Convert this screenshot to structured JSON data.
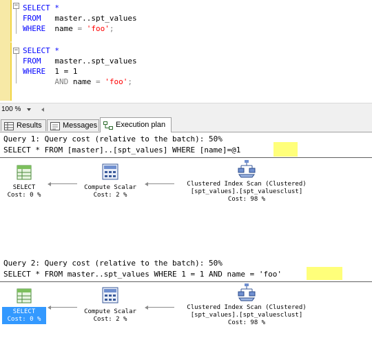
{
  "editor": {
    "block1": {
      "line1": "SELECT *",
      "line2_kw": "FROM",
      "line2_obj": "master..spt_values",
      "line3_kw": "WHERE",
      "line3_col": "name",
      "line3_op": "=",
      "line3_val": "'foo'",
      "line3_end": ";"
    },
    "block2": {
      "line1": "SELECT *",
      "line2_kw": "FROM",
      "line2_obj": "master..spt_values",
      "line3_kw": "WHERE",
      "line3_expr": "1 = 1",
      "line4_kw": "AND",
      "line4_col": "name",
      "line4_op": "=",
      "line4_val": "'foo'",
      "line4_end": ";"
    }
  },
  "zoom": {
    "value": "100 %"
  },
  "tabs": [
    {
      "label": "Results",
      "icon": "results-grid-icon"
    },
    {
      "label": "Messages",
      "icon": "messages-icon"
    },
    {
      "label": "Execution plan",
      "icon": "execution-plan-icon",
      "active": true
    }
  ],
  "plan": {
    "query1": {
      "header": "Query 1: Query cost (relative to the batch): 50%",
      "sql": "SELECT * FROM [master]..[spt_values] WHERE [name]=",
      "param": "@1",
      "nodes": [
        {
          "name": "SELECT",
          "cost": "Cost: 0 %",
          "icon": "select-icon"
        },
        {
          "name": "Compute Scalar",
          "cost": "Cost: 2 %",
          "icon": "compute-scalar-icon"
        },
        {
          "name": "Clustered Index Scan (Clustered)",
          "object": "[spt_values].[spt_valuesclust]",
          "cost": "Cost: 98 %",
          "icon": "clustered-index-scan-icon"
        }
      ]
    },
    "query2": {
      "header": "Query 2: Query cost (relative to the batch): 50%",
      "sql": "SELECT * FROM master..spt_values WHERE 1 = 1 AND name = ",
      "param": "'foo'",
      "nodes": [
        {
          "name": "SELECT",
          "cost": "Cost: 0 %",
          "icon": "select-icon",
          "selected": true
        },
        {
          "name": "Compute Scalar",
          "cost": "Cost: 2 %",
          "icon": "compute-scalar-icon"
        },
        {
          "name": "Clustered Index Scan (Clustered)",
          "object": "[spt_values].[spt_valuesclust]",
          "cost": "Cost: 98 %",
          "icon": "clustered-index-scan-icon"
        }
      ]
    }
  },
  "colors": {
    "keyword": "#0000ff",
    "string": "#ff0000",
    "operator": "#808080",
    "highlight": "#ffff7a",
    "selection": "#3399ff",
    "gutter": "#f7e9a6"
  }
}
